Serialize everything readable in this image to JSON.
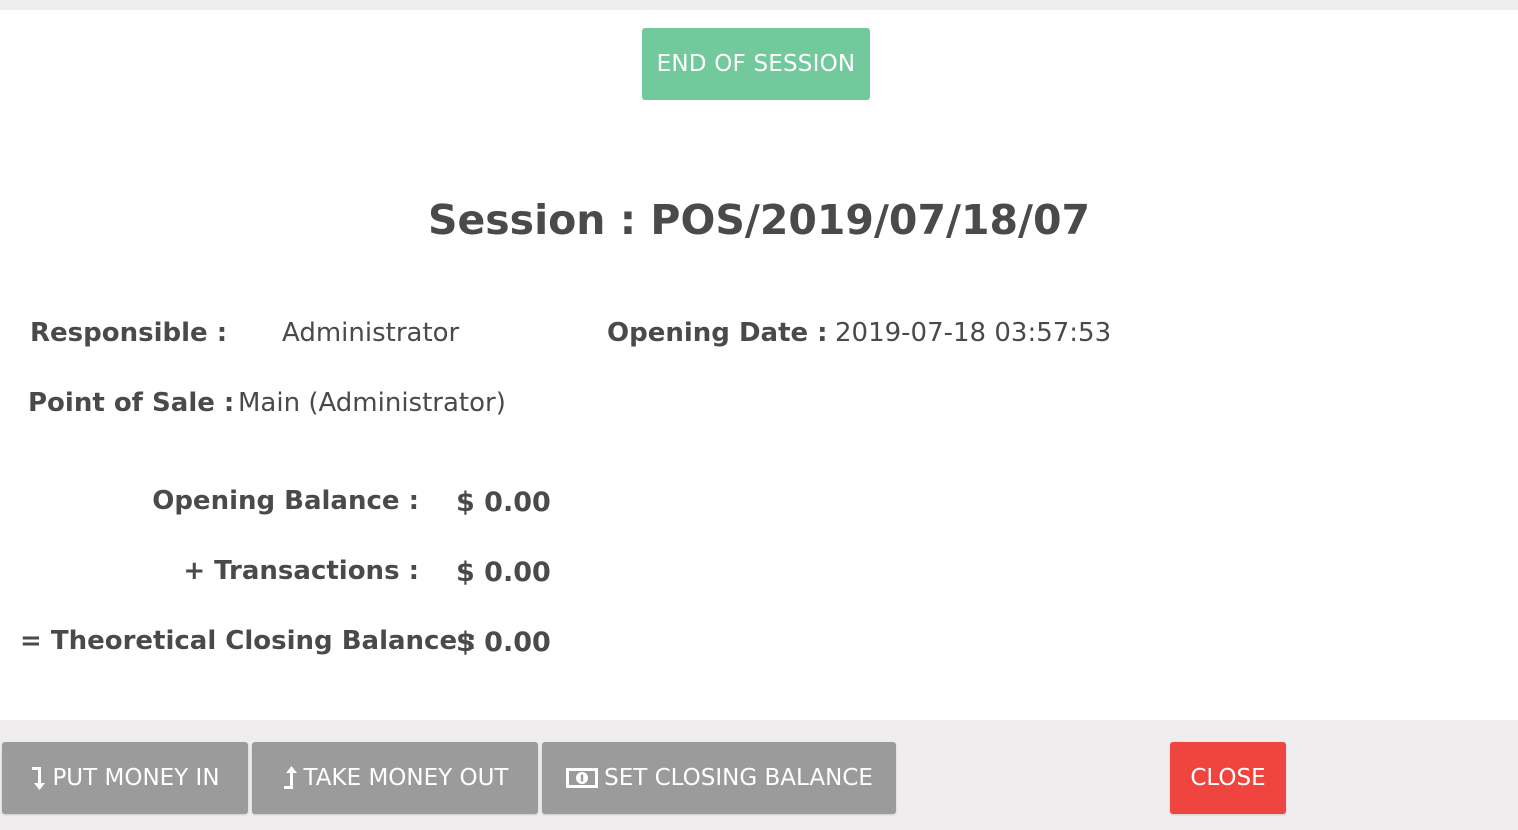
{
  "header": {
    "end_session_label": "END OF SESSION"
  },
  "title": "Session : POS/2019/07/18/07",
  "info": {
    "responsible_label": "Responsible :",
    "responsible_value": "Administrator",
    "opening_date_label": "Opening Date :",
    "opening_date_value": "2019-07-18 03:57:53",
    "pos_label": "Point of Sale :",
    "pos_value": "Main (Administrator)"
  },
  "balances": {
    "opening_label": "Opening Balance :",
    "opening_value": "$ 0.00",
    "transactions_label": "+ Transactions :",
    "transactions_value": "$ 0.00",
    "theoretical_label": "= Theoretical Closing Balance :",
    "theoretical_value": "$ 0.00"
  },
  "footer": {
    "put_money_in": "PUT MONEY IN",
    "take_money_out": "TAKE MONEY OUT",
    "set_closing_balance": "SET CLOSING BALANCE",
    "close": "CLOSE"
  },
  "icons": {
    "put_money_in": "arrow-down-turn-icon",
    "take_money_out": "arrow-up-turn-icon",
    "set_closing_balance": "money-bill-icon"
  },
  "colors": {
    "end_session_bg": "#72c99c",
    "footer_button_bg": "#9b9b9b",
    "close_bg": "#f0443e",
    "footer_bg": "#efeded",
    "text": "#4a4a4a"
  }
}
